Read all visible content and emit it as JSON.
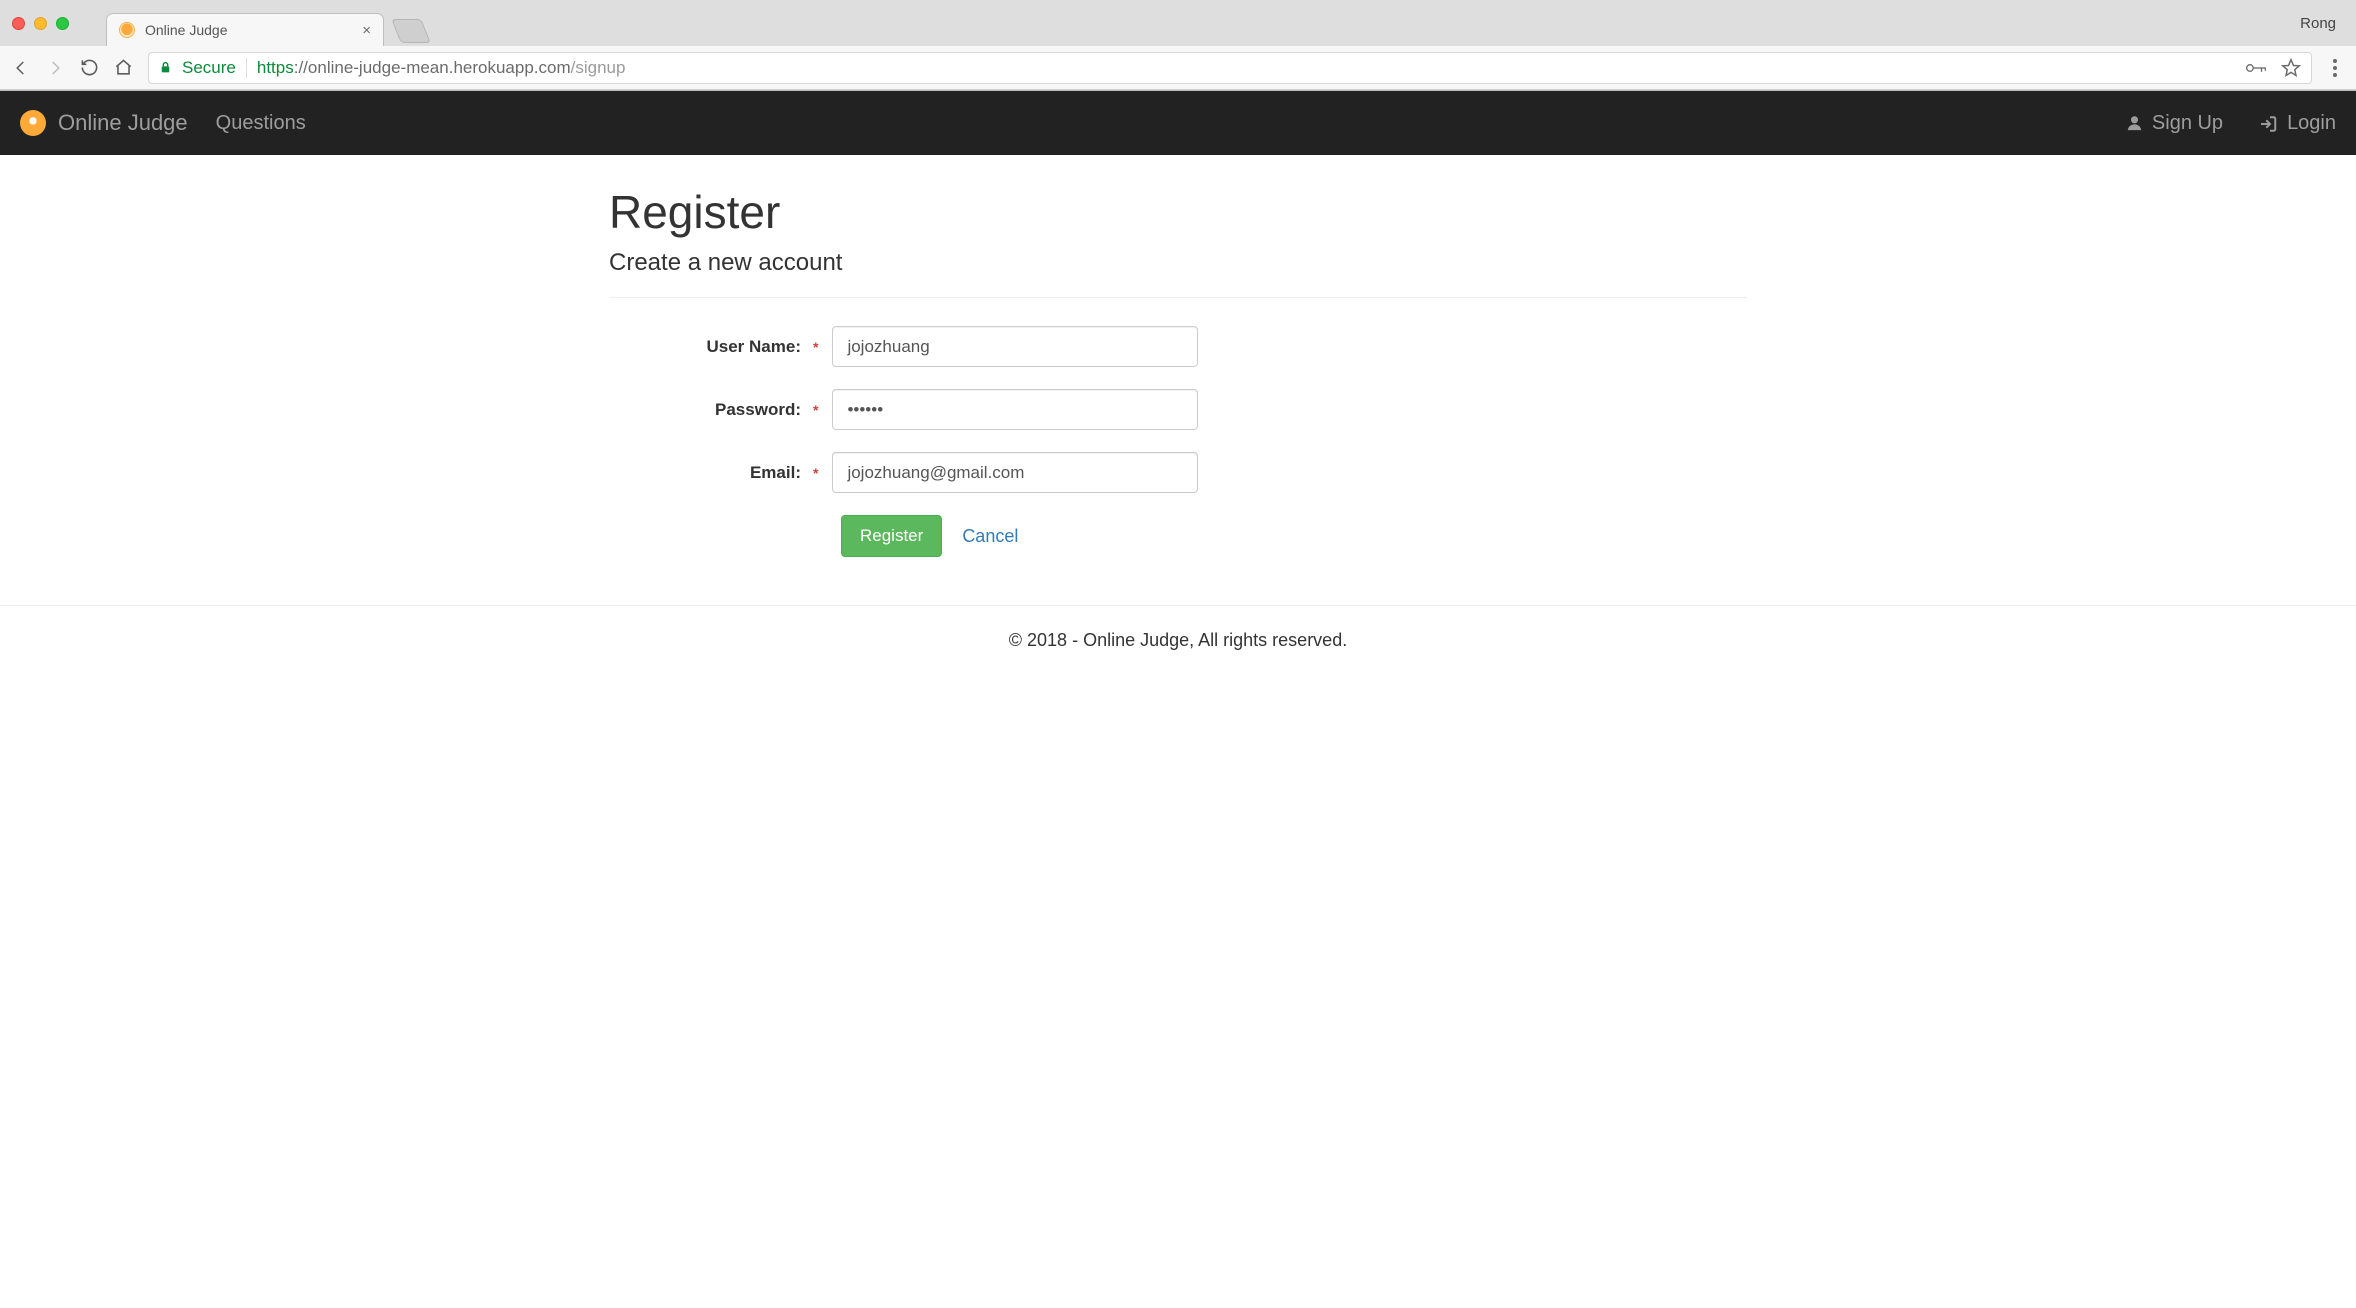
{
  "browser": {
    "profile_name": "Rong",
    "tab_title": "Online Judge",
    "secure_label": "Secure",
    "url_scheme": "https",
    "url_host_path": "://online-judge-mean.herokuapp.com",
    "url_tail": "/signup"
  },
  "navbar": {
    "brand": "Online Judge",
    "links": {
      "questions": "Questions"
    },
    "right": {
      "signup": "Sign Up",
      "login": "Login"
    }
  },
  "page": {
    "title": "Register",
    "subtitle": "Create a new account"
  },
  "form": {
    "username": {
      "label": "User Name:",
      "required_marker": "*",
      "value": "jojozhuang"
    },
    "password": {
      "label": "Password:",
      "required_marker": "*",
      "value": "••••••"
    },
    "email": {
      "label": "Email:",
      "required_marker": "*",
      "value": "jojozhuang@gmail.com"
    },
    "submit_label": "Register",
    "cancel_label": "Cancel"
  },
  "footer": {
    "text": "© 2018 - Online Judge, All rights reserved."
  }
}
